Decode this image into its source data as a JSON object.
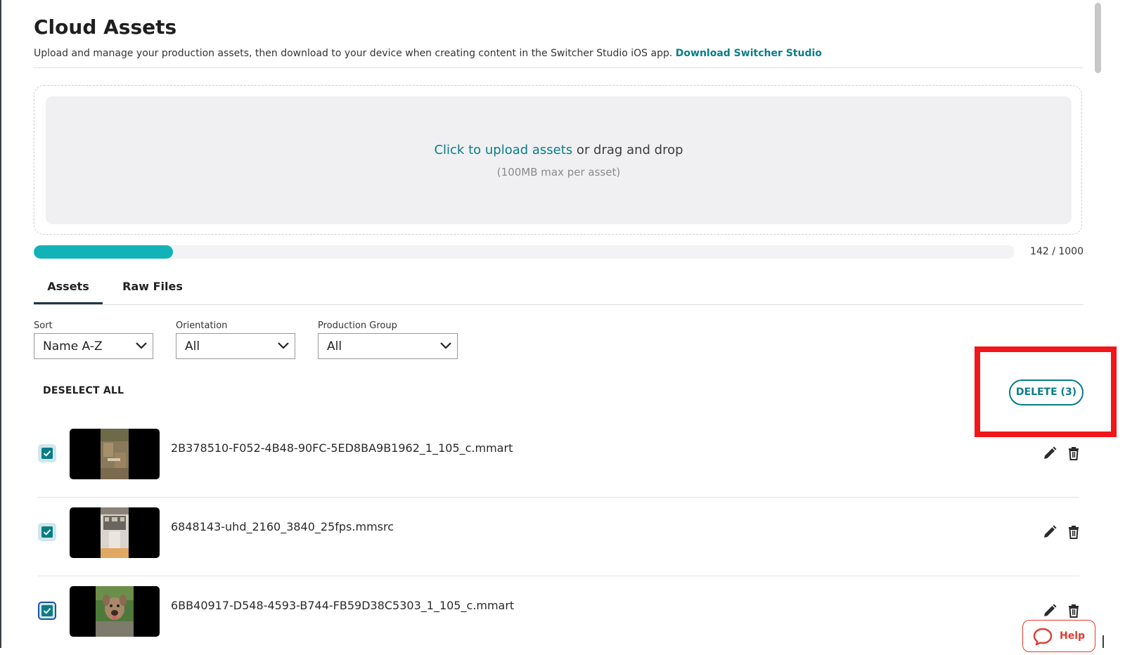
{
  "page": {
    "title": "Cloud Assets",
    "subtitle": "Upload and manage your production assets, then download to your device when creating content in the Switcher Studio iOS app.",
    "subtitle_link": "Download Switcher Studio"
  },
  "upload": {
    "link_text": "Click to upload assets",
    "text": " or drag and drop",
    "limit": "(100MB max per asset)"
  },
  "storage": {
    "used": 142,
    "total": 1000,
    "label": "142 / 1000",
    "accent": "#12b3b8"
  },
  "tabs": [
    {
      "label": "Assets",
      "active": true
    },
    {
      "label": "Raw Files",
      "active": false
    }
  ],
  "filters": {
    "sort": {
      "label": "Sort",
      "value": "Name A-Z"
    },
    "orientation": {
      "label": "Orientation",
      "value": "All"
    },
    "production_group": {
      "label": "Production Group",
      "value": "All"
    }
  },
  "actions": {
    "deselect_all": "DESELECT ALL",
    "delete": "DELETE (3)"
  },
  "assets": [
    {
      "name": "2B378510-F052-4B48-90FC-5ED8BA9B1962_1_105_c.mmart",
      "checked": true,
      "thumbnail": "portrait-photo-ground"
    },
    {
      "name": "6848143-uhd_2160_3840_25fps.mmsrc",
      "checked": true,
      "thumbnail": "portrait-video-building"
    },
    {
      "name": "6BB40917-D548-4593-B744-FB59D38C5303_1_105_c.mmart",
      "checked": true,
      "thumbnail": "portrait-photo-dog"
    }
  ],
  "icons": {
    "edit": "pencil-icon",
    "delete": "trash-icon",
    "check": "check-icon",
    "chevron": "chevron-down-icon",
    "help": "chat-bubble-icon"
  },
  "help": {
    "label": "Help",
    "color": "#e23b2e"
  },
  "colors": {
    "brand": "#0a7d86",
    "highlight": "#f0161a"
  }
}
